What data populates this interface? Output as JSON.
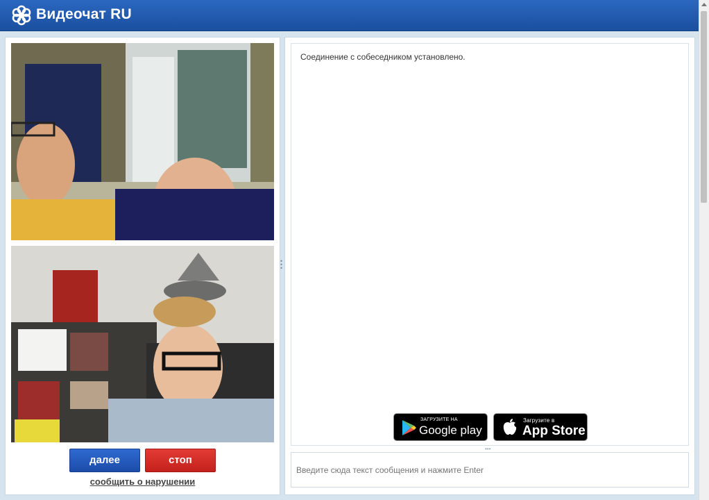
{
  "app": {
    "title": "Видеочат RU"
  },
  "chat": {
    "status_message": "Соединение с собеседником установлено.",
    "input_placeholder": "Введите сюда текст сообщения и нажмите Enter"
  },
  "controls": {
    "next_label": "далее",
    "stop_label": "стоп",
    "report_label": "сообщить о нарушении"
  },
  "badges": {
    "google_small": "ЗАГРУЗИТЕ НА",
    "google_big": "Google play",
    "apple_small": "Загрузите в",
    "apple_big": "App Store"
  },
  "colors": {
    "header": "#1e58ad",
    "next_button": "#2358b8",
    "stop_button": "#d22c25"
  }
}
